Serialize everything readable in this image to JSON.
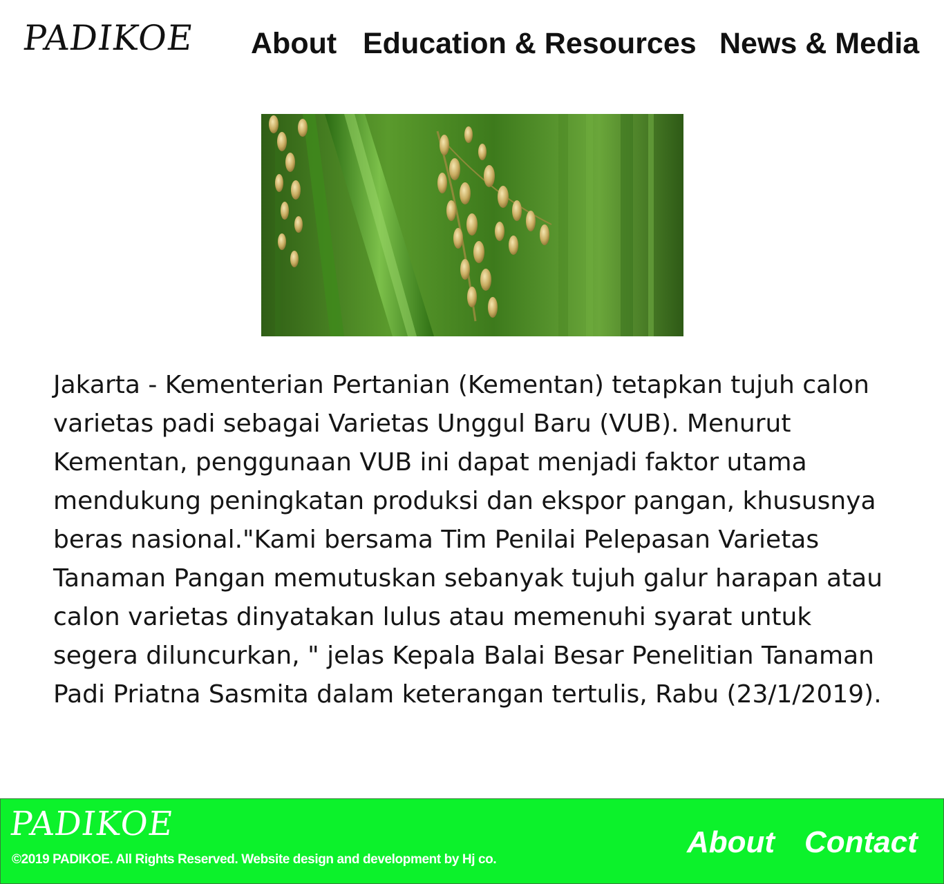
{
  "header": {
    "logo": "PADIKOE",
    "nav": [
      {
        "label": "About"
      },
      {
        "label": "Education & Resources"
      },
      {
        "label": "News & Media"
      }
    ]
  },
  "hero": {
    "icon": "rice-plant-photo"
  },
  "article": {
    "body": "Jakarta - Kementerian Pertanian (Kementan) tetapkan tujuh calon varietas padi sebagai Varietas Unggul Baru (VUB). Menurut Kementan, penggunaan VUB ini dapat menjadi faktor utama mendukung peningkatan produksi dan ekspor pangan, khususnya beras nasional.\"Kami bersama Tim Penilai Pelepasan Varietas Tanaman Pangan memutuskan sebanyak tujuh galur harapan atau calon varietas dinyatakan lulus atau memenuhi syarat untuk segera diluncurkan, \" jelas Kepala Balai Besar Penelitian Tanaman Padi Priatna Sasmita dalam keterangan tertulis, Rabu (23/1/2019)."
  },
  "footer": {
    "logo": "PADIKOE",
    "copyright": "©2019 PADIKOE. All Rights Reserved. Website design and development by Hj co.",
    "links": [
      {
        "label": "About"
      },
      {
        "label": "Contact"
      }
    ],
    "background_color": "#0cf22b"
  }
}
